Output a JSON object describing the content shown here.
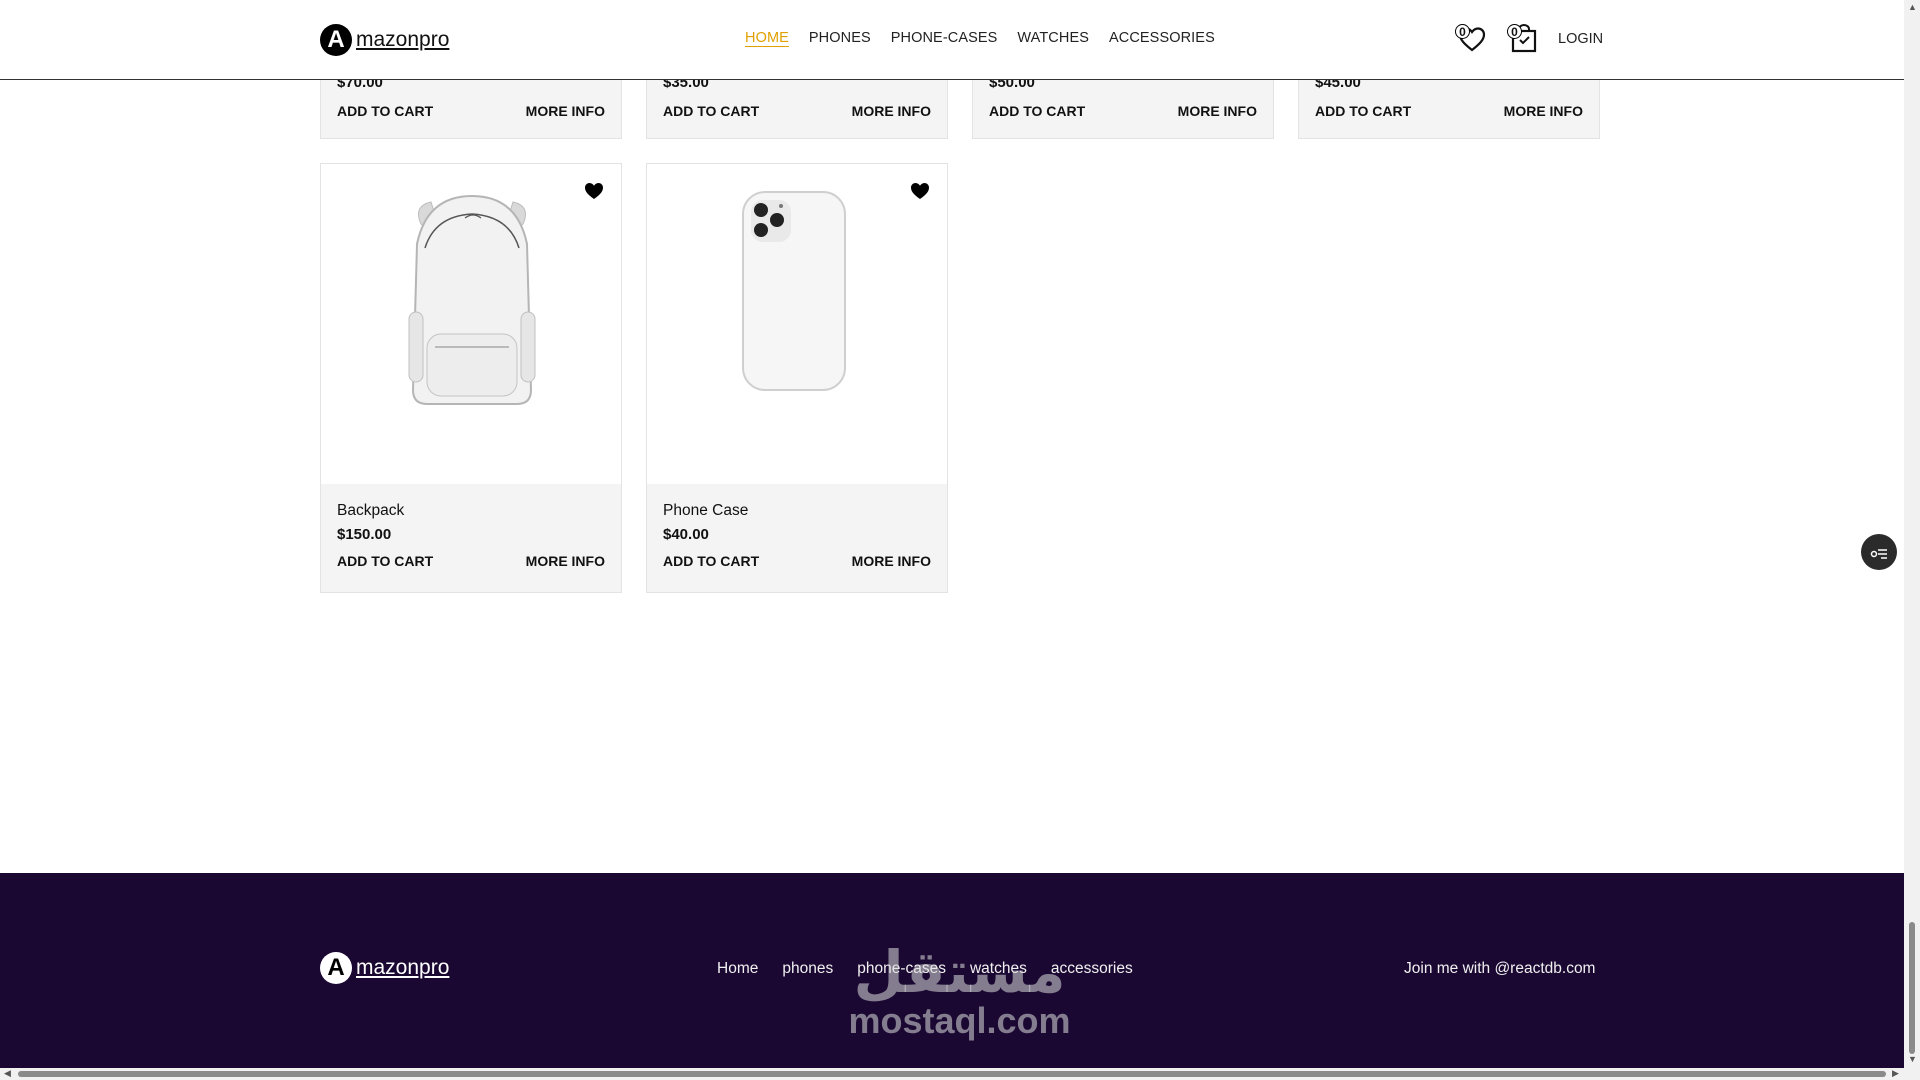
{
  "header": {
    "logo_letter": "A",
    "logo_text": "mazonpro",
    "nav": [
      "HOME",
      "PHONES",
      "PHONE-CASES",
      "WATCHES",
      "ACCESSORIES"
    ],
    "active_nav": "HOME",
    "wishlist_count": "0",
    "cart_count": "0",
    "login_label": "LOGIN"
  },
  "top_row": [
    {
      "price": "$70.00",
      "add": "ADD TO CART",
      "more": "MORE INFO"
    },
    {
      "price": "$35.00",
      "add": "ADD TO CART",
      "more": "MORE INFO"
    },
    {
      "price": "$50.00",
      "add": "ADD TO CART",
      "more": "MORE INFO"
    },
    {
      "price": "$45.00",
      "add": "ADD TO CART",
      "more": "MORE INFO"
    }
  ],
  "products": [
    {
      "name": "Backpack",
      "price": "$150.00",
      "add": "ADD TO CART",
      "more": "MORE INFO"
    },
    {
      "name": "Phone Case",
      "price": "$40.00",
      "add": "ADD TO CART",
      "more": "MORE INFO"
    }
  ],
  "footer": {
    "logo_letter": "A",
    "logo_text": "mazonpro",
    "links": [
      "Home",
      "phones",
      "phone-cases",
      "watches",
      "accessories"
    ],
    "note": "Join me with @reactdb.com",
    "watermark_ar": "مستقل",
    "watermark_en": "mostaql.com"
  },
  "colors": {
    "accent": "#e0a100",
    "footer_bg": "#1a0832",
    "card_bg": "#f4f4f5"
  }
}
